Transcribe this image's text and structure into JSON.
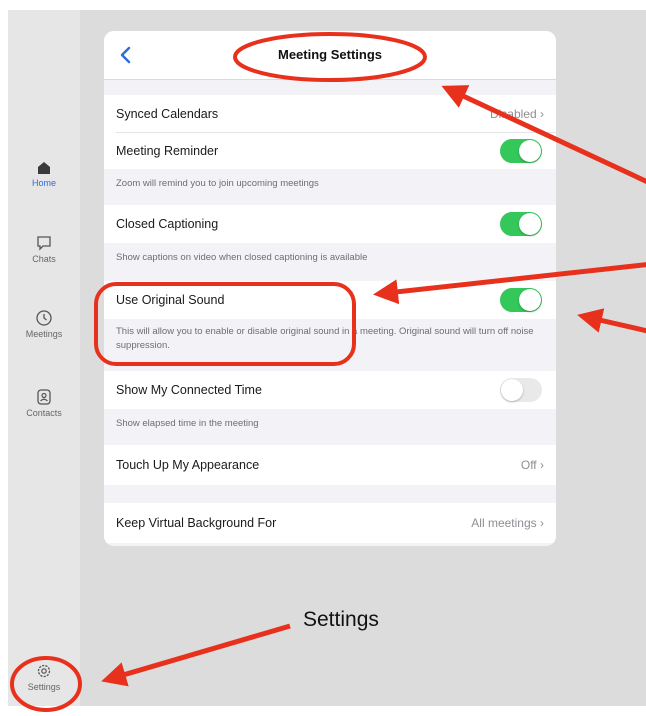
{
  "sidebar": {
    "items": [
      {
        "label": "Home",
        "icon": "home-icon",
        "active": true
      },
      {
        "label": "Chats",
        "icon": "chat-bubble-icon"
      },
      {
        "label": "Meetings",
        "icon": "clock-icon"
      },
      {
        "label": "Contacts",
        "icon": "contact-card-icon"
      },
      {
        "label": "Settings",
        "icon": "gear-icon"
      }
    ]
  },
  "panel": {
    "title": "Meeting Settings",
    "back_icon": "chevron-left-icon",
    "rows": [
      {
        "label": "Synced Calendars",
        "value": "Disabled"
      },
      {
        "label": "Meeting Reminder",
        "toggle": "on",
        "desc": "Zoom will remind you to join upcoming meetings"
      },
      {
        "label": "Closed Captioning",
        "toggle": "on",
        "desc": "Show captions on video when closed captioning is available"
      },
      {
        "label": "Use Original Sound",
        "toggle": "on",
        "desc": "This will allow you to enable or disable original sound in a meeting. Original sound will turn off noise suppression."
      },
      {
        "label": "Show My Connected Time",
        "toggle": "off",
        "desc": "Show elapsed time in the meeting"
      },
      {
        "label": "Touch Up My Appearance",
        "value": "Off"
      },
      {
        "label": "Keep Virtual Background For",
        "value": "All meetings"
      }
    ]
  },
  "annotation": {
    "settings_caption": "Settings",
    "highlight_color": "#e8311c"
  },
  "colors": {
    "toggle_on": "#34c759",
    "accent": "#2d6cdf"
  }
}
